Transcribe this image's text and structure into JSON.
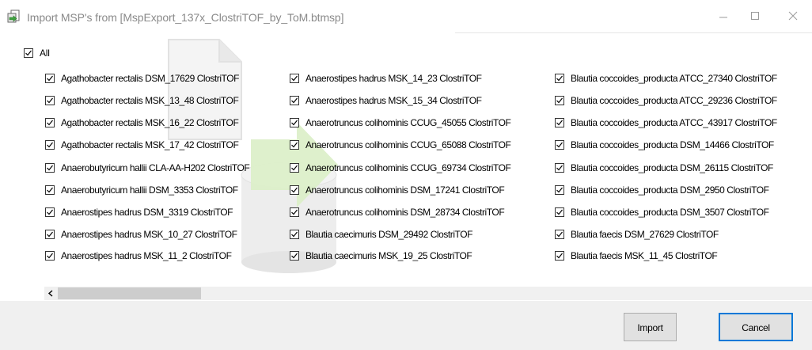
{
  "window": {
    "title": "Import MSP's from [MspExport_137x_ClostriTOF_by_ToM.btmsp]",
    "icon": "import-app-icon",
    "controls": [
      "minimize-icon",
      "maximize-icon",
      "close-icon"
    ]
  },
  "all_checkbox": {
    "label": "All",
    "checked": true
  },
  "columns": [
    {
      "items": [
        {
          "label": "Agathobacter rectalis DSM_17629 ClostriTOF",
          "checked": true
        },
        {
          "label": "Agathobacter rectalis MSK_13_48 ClostriTOF",
          "checked": true
        },
        {
          "label": "Agathobacter rectalis MSK_16_22 ClostriTOF",
          "checked": true
        },
        {
          "label": "Agathobacter rectalis MSK_17_42 ClostriTOF",
          "checked": true
        },
        {
          "label": "Anaerobutyricum hallii CLA-AA-H202 ClostriTOF",
          "checked": true
        },
        {
          "label": "Anaerobutyricum hallii DSM_3353 ClostriTOF",
          "checked": true
        },
        {
          "label": "Anaerostipes hadrus DSM_3319 ClostriTOF",
          "checked": true
        },
        {
          "label": "Anaerostipes hadrus MSK_10_27 ClostriTOF",
          "checked": true
        },
        {
          "label": "Anaerostipes hadrus MSK_11_2 ClostriTOF",
          "checked": true
        }
      ]
    },
    {
      "items": [
        {
          "label": "Anaerostipes hadrus MSK_14_23 ClostriTOF",
          "checked": true
        },
        {
          "label": "Anaerostipes hadrus MSK_15_34 ClostriTOF",
          "checked": true
        },
        {
          "label": "Anaerotruncus colihominis CCUG_45055 ClostriTOF",
          "checked": true
        },
        {
          "label": "Anaerotruncus colihominis CCUG_65088 ClostriTOF",
          "checked": true
        },
        {
          "label": "Anaerotruncus colihominis CCUG_69734 ClostriTOF",
          "checked": true
        },
        {
          "label": "Anaerotruncus colihominis DSM_17241 ClostriTOF",
          "checked": true
        },
        {
          "label": "Anaerotruncus colihominis DSM_28734 ClostriTOF",
          "checked": true
        },
        {
          "label": "Blautia caecimuris DSM_29492 ClostriTOF",
          "checked": true
        },
        {
          "label": "Blautia caecimuris MSK_19_25 ClostriTOF",
          "checked": true
        }
      ]
    },
    {
      "items": [
        {
          "label": "Blautia coccoides_producta ATCC_27340 ClostriTOF",
          "checked": true
        },
        {
          "label": "Blautia coccoides_producta ATCC_29236 ClostriTOF",
          "checked": true
        },
        {
          "label": "Blautia coccoides_producta ATCC_43917 ClostriTOF",
          "checked": true
        },
        {
          "label": "Blautia coccoides_producta DSM_14466 ClostriTOF",
          "checked": true
        },
        {
          "label": "Blautia coccoides_producta DSM_26115 ClostriTOF",
          "checked": true
        },
        {
          "label": "Blautia coccoides_producta DSM_2950 ClostriTOF",
          "checked": true
        },
        {
          "label": "Blautia coccoides_producta DSM_3507 ClostriTOF",
          "checked": true
        },
        {
          "label": "Blautia faecis DSM_27629 ClostriTOF",
          "checked": true
        },
        {
          "label": "Blautia faecis MSK_11_45 ClostriTOF",
          "checked": true
        }
      ]
    }
  ],
  "scrollbar": {
    "left_arrow": "<",
    "position": 0.0
  },
  "buttons": {
    "import": "Import",
    "cancel": "Cancel"
  },
  "colors": {
    "accent": "#0078d7",
    "footer_bg": "#f0f0f0",
    "button_bg": "#e1e1e1"
  }
}
